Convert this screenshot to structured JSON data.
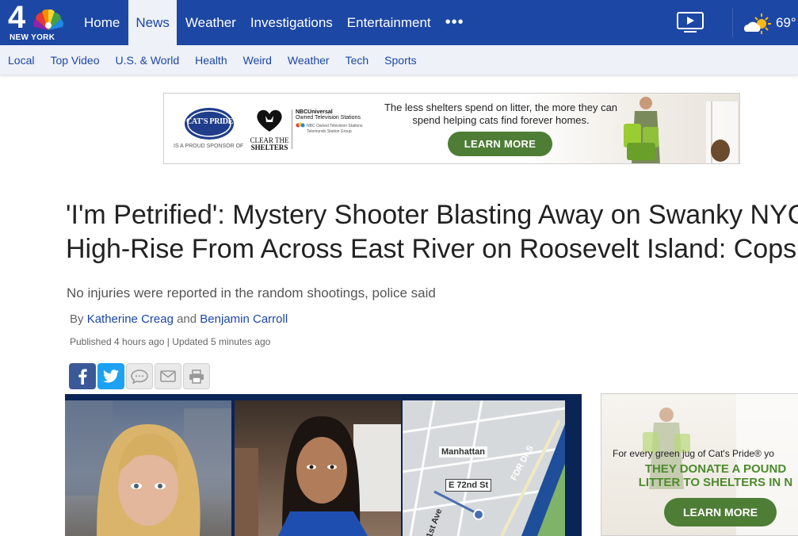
{
  "brand": {
    "logo_number": "4",
    "city": "NEW YORK"
  },
  "topnav": {
    "items": [
      {
        "label": "Home",
        "active": false
      },
      {
        "label": "News",
        "active": true
      },
      {
        "label": "Weather",
        "active": false
      },
      {
        "label": "Investigations",
        "active": false
      },
      {
        "label": "Entertainment",
        "active": false
      }
    ],
    "more_label": "•••",
    "temperature": "69°",
    "icons": [
      "tv-icon",
      "weather-partly-sunny-icon"
    ]
  },
  "subnav": {
    "items": [
      "Local",
      "Top Video",
      "U.S. & World",
      "Health",
      "Weird",
      "Weather",
      "Tech",
      "Sports"
    ]
  },
  "banner_ad": {
    "brand": "CAT'S PRIDE",
    "sponsor_note": "IS A PROUD SPONSOR OF",
    "cts_line1": "CLEAR THE",
    "cts_line2": "SHELTERS",
    "nbcu_line1": "NBCUniversal",
    "nbcu_line2": "Owned Television Stations",
    "nbcu_line3": "NBC Owned Television Stations",
    "nbcu_line4": "Telemundo Station Group",
    "copy": "The less shelters spend on litter, the more they can spend helping cats find forever homes.",
    "button": "LEARN MORE"
  },
  "article": {
    "headline_line1": "'I'm Petrified': Mystery Shooter Blasting Away on Swanky NYC",
    "headline_line2": "High-Rise From Across East River on Roosevelt Island: Cops",
    "dek": "No injuries were reported in the random shootings, police said",
    "by": "By",
    "author1": "Katherine Creag",
    "and": "and",
    "author2": "Benjamin Carroll",
    "published": "Published 4 hours ago",
    "separator": "|",
    "updated": "Updated 5 minutes ago"
  },
  "share": {
    "buttons": [
      "facebook-icon",
      "twitter-icon",
      "comment-icon",
      "email-icon",
      "print-icon"
    ]
  },
  "video": {
    "map_labels": {
      "manhattan": "Manhattan",
      "street": "E 72nd St",
      "fdr": "FDR Dr S",
      "avenue": "1st Ave"
    }
  },
  "side_ad": {
    "line1": "For every green jug of Cat's Pride® yo",
    "line2": "THEY DONATE A POUND",
    "line3": "LITTER TO SHELTERS IN N",
    "button": "LEARN MORE"
  },
  "colors": {
    "nav_blue": "#1c47a4",
    "subnav_bg": "#eef1f7",
    "ad_green": "#4e7d36"
  }
}
